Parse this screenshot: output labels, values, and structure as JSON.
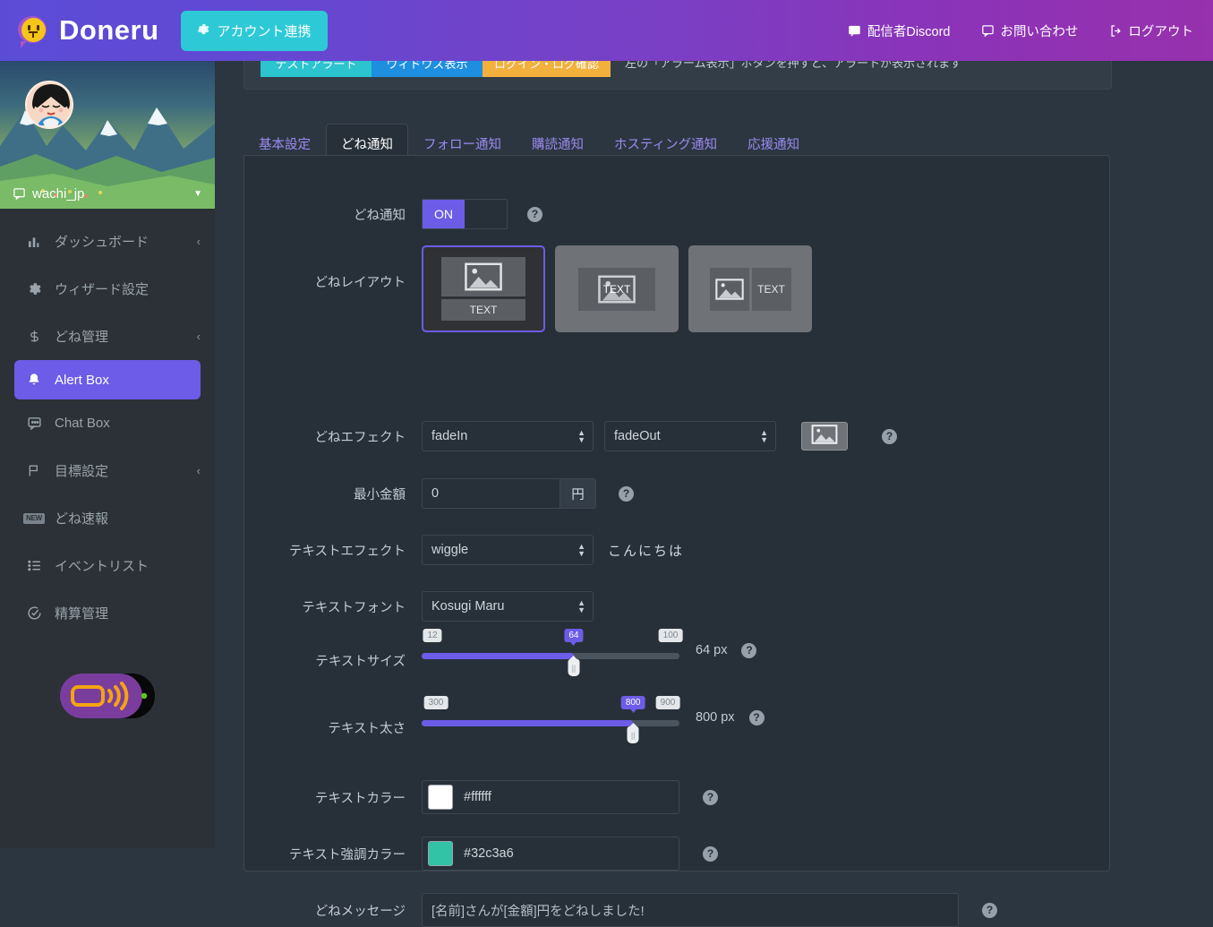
{
  "header": {
    "brand": "Doneru",
    "account_link_label": "アカウント連携",
    "links": [
      {
        "label": "配信者Discord",
        "icon": "discord-chat-icon"
      },
      {
        "label": "お問い合わせ",
        "icon": "message-icon"
      },
      {
        "label": "ログアウト",
        "icon": "logout-icon"
      }
    ]
  },
  "sidebar": {
    "username": "wachi_jp",
    "items": [
      {
        "label": "ダッシュボード",
        "icon": "bar-chart-icon",
        "caret": "‹",
        "active": false,
        "badge": ""
      },
      {
        "label": "ウィザード設定",
        "icon": "gear-icon",
        "caret": "",
        "active": false,
        "badge": ""
      },
      {
        "label": "どね管理",
        "icon": "dollar-icon",
        "caret": "‹",
        "active": false,
        "badge": ""
      },
      {
        "label": "Alert Box",
        "icon": "bell-icon",
        "caret": "",
        "active": true,
        "badge": ""
      },
      {
        "label": "Chat Box",
        "icon": "chat-icon",
        "caret": "",
        "active": false,
        "badge": ""
      },
      {
        "label": "目標設定",
        "icon": "flag-icon",
        "caret": "‹",
        "active": false,
        "badge": ""
      },
      {
        "label": "どね速報",
        "icon": "new-badge-icon",
        "caret": "",
        "active": false,
        "badge": "NEW"
      },
      {
        "label": "イベントリスト",
        "icon": "list-icon",
        "caret": "",
        "active": false,
        "badge": ""
      },
      {
        "label": "精算管理",
        "icon": "check-circle-icon",
        "caret": "",
        "active": false,
        "badge": ""
      }
    ]
  },
  "top_strip": {
    "buttons": [
      {
        "label": "テストアラート",
        "color": "#2bc4cf"
      },
      {
        "label": "ウィドウズ表示",
        "color": "#1e8fe0"
      },
      {
        "label": "ログイン・ログ確認",
        "color": "#f2b03c"
      }
    ],
    "note": "左の「アラーム表示」ボタンを押すと、アラートが表示されます"
  },
  "tabs": [
    {
      "label": "基本設定",
      "active": false
    },
    {
      "label": "どね通知",
      "active": true
    },
    {
      "label": "フォロー通知",
      "active": false
    },
    {
      "label": "購読通知",
      "active": false
    },
    {
      "label": "ホスティング通知",
      "active": false
    },
    {
      "label": "応援通知",
      "active": false
    }
  ],
  "form": {
    "notify": {
      "label": "どね通知",
      "state": "ON"
    },
    "layout": {
      "label": "どねレイアウト",
      "options": [
        {
          "name": "image-above-text",
          "text": "TEXT",
          "selected": true
        },
        {
          "name": "text-over-image",
          "text": "TEXT",
          "selected": false
        },
        {
          "name": "image-beside-text",
          "text": "TEXT",
          "selected": false
        }
      ]
    },
    "effect": {
      "label": "どねエフェクト",
      "in_value": "fadeIn",
      "out_value": "fadeOut",
      "image_button": "image-icon"
    },
    "min_amount": {
      "label": "最小金額",
      "value": "0",
      "unit": "円"
    },
    "text_effect": {
      "label": "テキストエフェクト",
      "value": "wiggle",
      "preview": "こんにちは"
    },
    "text_font": {
      "label": "テキストフォント",
      "value": "Kosugi Maru"
    },
    "text_size": {
      "label": "テキストサイズ",
      "min": "12",
      "max": "100",
      "value": "64",
      "display": "64 px",
      "percent": 59
    },
    "text_weight": {
      "label": "テキスト太さ",
      "min": "300",
      "max": "900",
      "value": "800",
      "display": "800 px",
      "percent": 82
    },
    "text_color": {
      "label": "テキストカラー",
      "value": "#ffffff",
      "swatch": "#ffffff"
    },
    "text_accent_color": {
      "label": "テキスト強調カラー",
      "value": "#32c3a6",
      "swatch": "#32c3a6"
    },
    "message": {
      "label": "どねメッセージ",
      "value": "[名前]さんが[金額]円をどねしました!"
    }
  },
  "colors": {
    "brand_purple": "#6c5ce7",
    "accent_teal": "#2bc4cf",
    "panel_bg": "#273039",
    "page_bg": "#2c3640",
    "sidebar_bg": "#2b3137"
  }
}
